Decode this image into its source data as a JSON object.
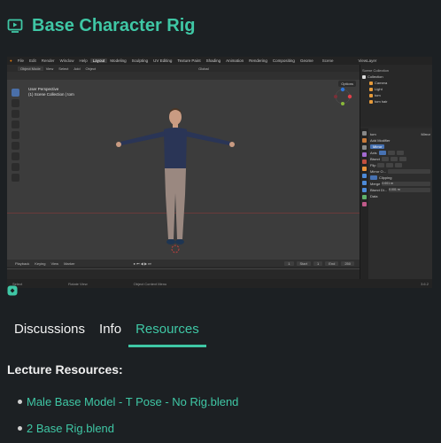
{
  "header": {
    "title": "Base Character Rig",
    "icon": "play-video-icon"
  },
  "video": {
    "blender": {
      "menu": [
        "File",
        "Edit",
        "Render",
        "Window",
        "Help"
      ],
      "workspaces": [
        "Layout",
        "Modeling",
        "Sculpting",
        "UV Editing",
        "Texture Paint",
        "Shading",
        "Animation",
        "Rendering",
        "Compositing",
        "Geome"
      ],
      "active_workspace": "Layout",
      "scene_label": "Scene",
      "view_layer_label": "ViewLayer",
      "mode_label": "Object Mode",
      "header_menu": [
        "View",
        "Select",
        "Add",
        "Object"
      ],
      "transform_label": "Global",
      "viewport_text_1": "User Perspective",
      "viewport_text_2": "(1) Scene Collection | tom",
      "options_label": "Options",
      "timeline_menu": [
        "Playback",
        "Keying",
        "View",
        "Marker"
      ],
      "frame_current": "1",
      "start_label": "Start",
      "start_value": "1",
      "end_label": "End",
      "end_value": "250",
      "status_select": "Select",
      "status_rotate": "Rotate View",
      "status_context": "Object Context Menu",
      "version": "3.6.2",
      "outliner": {
        "header": "Scene Collection",
        "items": [
          "Collection",
          "Camera",
          "Light",
          "tom",
          "tom hair"
        ]
      },
      "properties": {
        "object_name": "tom",
        "modifier_name": "Mirror",
        "add_modifier": "Add Modifier",
        "axis_label": "Axis",
        "bisect_label": "Bisect",
        "flip_label": "Flip",
        "mirror_object_label": "Mirror O...",
        "clipping_label": "Clipping",
        "merge_label": "Merge",
        "merge_value": "0.001 m",
        "bisect_dist_label": "Bisect Di...",
        "bisect_dist_value": "0.001 m",
        "data_label": "Data"
      },
      "accent_color": "#4772b3"
    }
  },
  "tabs": [
    {
      "label": "Discussions",
      "active": false
    },
    {
      "label": "Info",
      "active": false
    },
    {
      "label": "Resources",
      "active": true
    }
  ],
  "resources": {
    "title": "Lecture Resources:",
    "items": [
      "Male Base Model - T Pose - No Rig.blend",
      "2 Base Rig.blend"
    ]
  },
  "colors": {
    "accent": "#3fc7a5",
    "background": "#1c2023"
  }
}
